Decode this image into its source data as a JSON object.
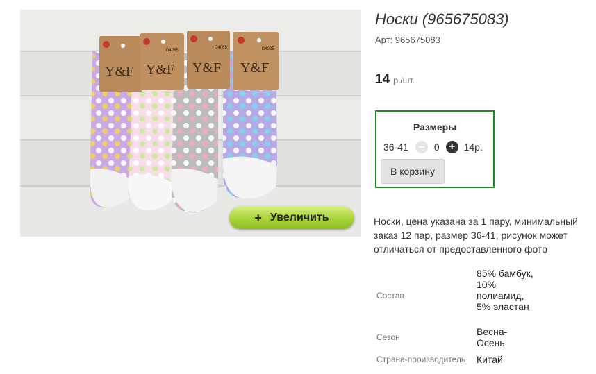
{
  "product": {
    "title": "Носки (965675083)",
    "article": "Арт: 965675083",
    "price_value": "14",
    "price_unit": "р./шт.",
    "zoom_button": "+ Увеличить",
    "zoom_plus": "+",
    "zoom_label": "Увеличить",
    "photo_brand": "Y&F",
    "photo_code": "D4085",
    "description": "Носки, цена указана за 1 пару, минимальный заказ 12 пар, размер 36-41, рисунок может отличаться от предоставленного фото"
  },
  "sizes": {
    "title": "Размеры",
    "size": "36-41",
    "quantity": "0",
    "price": "14р.",
    "minus_icon": "minus-circle-icon",
    "plus_icon": "plus-circle-icon",
    "cart_button": "В корзину",
    "border_color": "#1f8a1f"
  },
  "specs": [
    {
      "label": "Состав",
      "value": "85% бамбук, 10% полиамид, 5% эластан"
    },
    {
      "label": "Сезон",
      "value": "Весна-Осень"
    },
    {
      "label": "Страна-производитель",
      "value": "Китай"
    }
  ],
  "colors": {
    "zoom_button": "#a8d23a",
    "sock_lilac": "#c9a9e6",
    "sock_pink": "#f6dde8",
    "sock_grey": "#bcbcbc",
    "sock_lavender": "#b7a8e6",
    "label_kraft": "#b98a5c"
  }
}
